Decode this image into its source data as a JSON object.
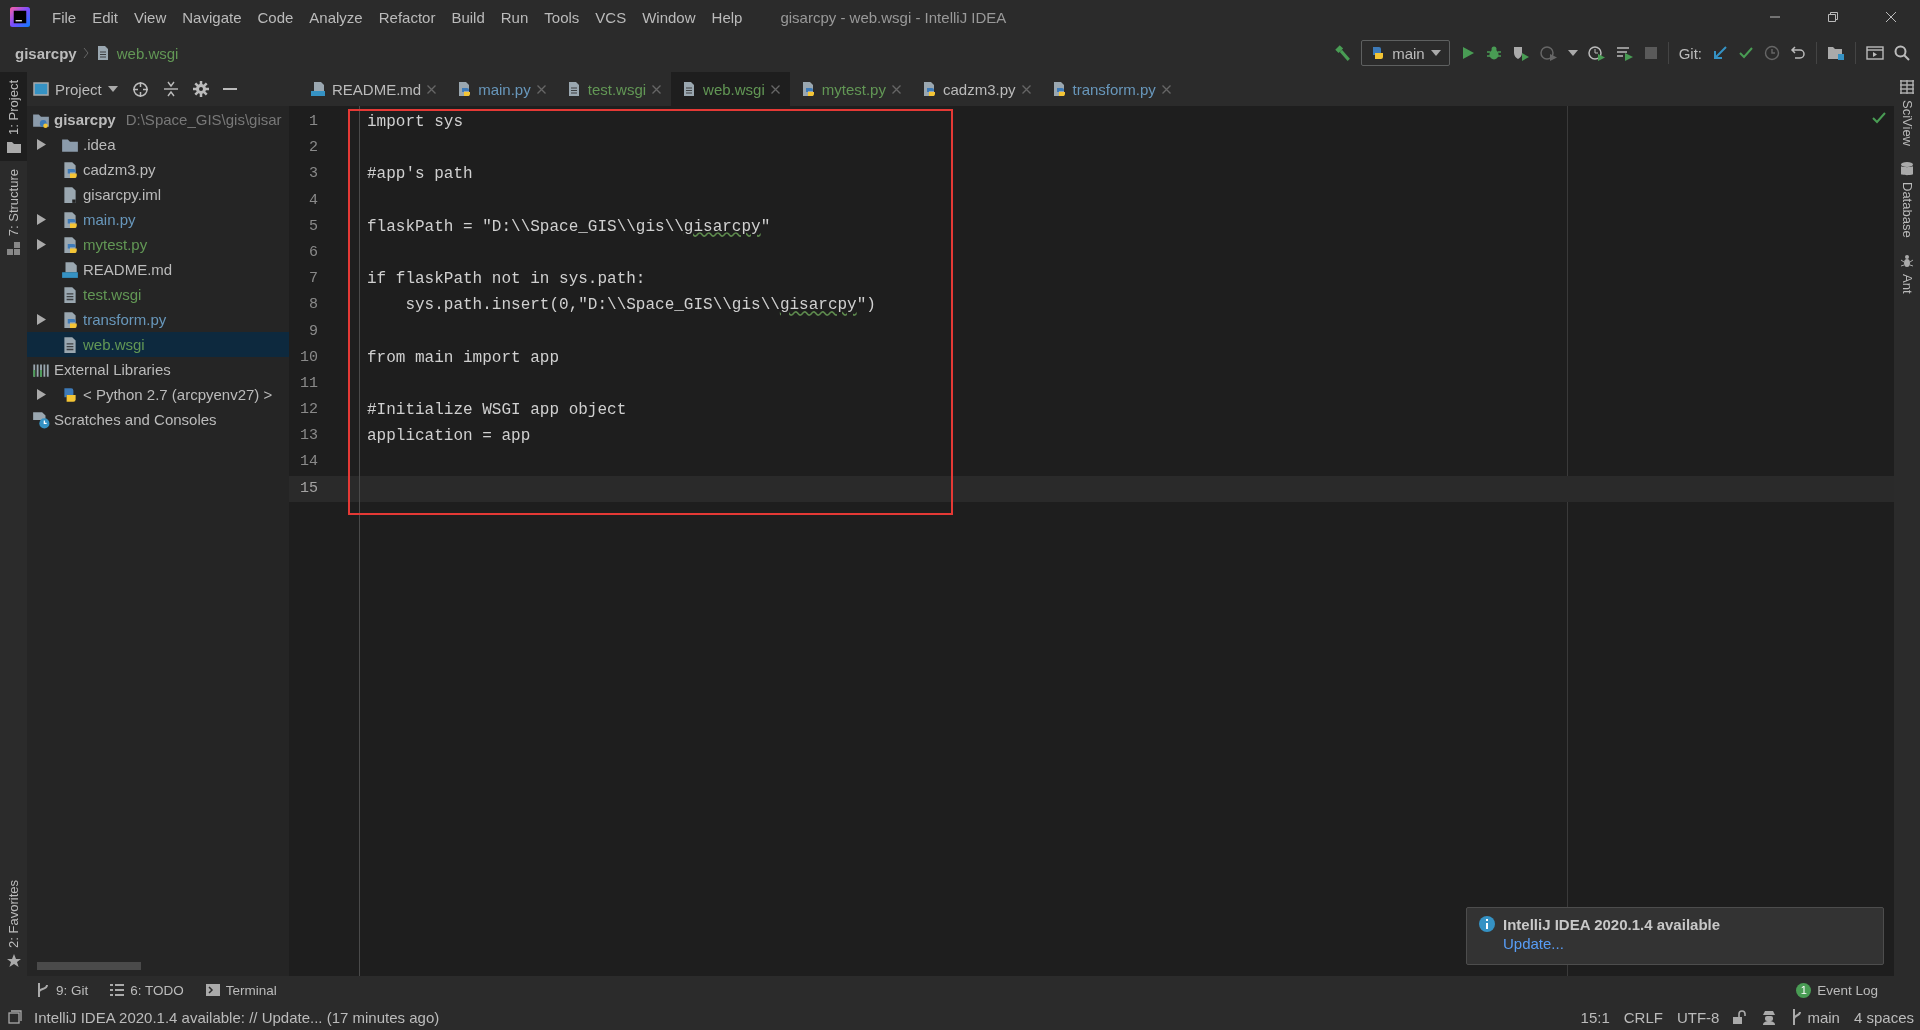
{
  "window": {
    "title": "gisarcpy - web.wsgi - IntelliJ IDEA"
  },
  "menu": [
    "File",
    "Edit",
    "View",
    "Navigate",
    "Code",
    "Analyze",
    "Refactor",
    "Build",
    "Run",
    "Tools",
    "VCS",
    "Window",
    "Help"
  ],
  "breadcrumb": [
    {
      "text": "gisarcpy",
      "kind": "project"
    },
    {
      "text": "web.wsgi",
      "kind": "file",
      "color": "#629755"
    }
  ],
  "toolbar": {
    "run_config": "main",
    "git_label": "Git:"
  },
  "left_stripe": {
    "top": [
      {
        "label": "1: Project",
        "kind": "project",
        "selected": true
      },
      {
        "label": "7: Structure",
        "kind": "structure",
        "selected": false
      }
    ],
    "bottom": [
      {
        "label": "2: Favorites",
        "kind": "favorites",
        "selected": false
      }
    ]
  },
  "project_panel": {
    "title": "Project",
    "tree": [
      {
        "name": "gisarcpy",
        "path": "D:\\Space_GIS\\gis\\gisar",
        "kind": "project",
        "selected": false,
        "children": [
          {
            "name": ".idea",
            "kind": "folder",
            "color": "#bbbbbb",
            "expanded": false,
            "selected": false
          },
          {
            "name": "cadzm3.py",
            "kind": "python",
            "color": "#bbbbbb",
            "selected": false
          },
          {
            "name": "gisarcpy.iml",
            "kind": "module",
            "color": "#bbbbbb",
            "selected": false
          },
          {
            "name": "main.py",
            "kind": "python",
            "color": "#6897bb",
            "expanded": false,
            "selected": false
          },
          {
            "name": "mytest.py",
            "kind": "python",
            "color": "#629755",
            "expanded": false,
            "selected": false
          },
          {
            "name": "README.md",
            "kind": "markdown",
            "color": "#bbbbbb",
            "selected": false
          },
          {
            "name": "test.wsgi",
            "kind": "text",
            "color": "#629755",
            "selected": false
          },
          {
            "name": "transform.py",
            "kind": "python",
            "color": "#6897bb",
            "expanded": false,
            "selected": false
          },
          {
            "name": "web.wsgi",
            "kind": "text",
            "color": "#629755",
            "selected": true
          }
        ]
      },
      {
        "name": "External Libraries",
        "kind": "libraries",
        "selected": false,
        "children": [
          {
            "name": "< Python 2.7 (arcpyenv27) >",
            "kind": "sdk",
            "expanded": false,
            "selected": false
          }
        ]
      },
      {
        "name": "Scratches and Consoles",
        "kind": "scratches",
        "selected": false
      }
    ]
  },
  "editor": {
    "tabs": [
      {
        "label": "README.md",
        "kind": "markdown",
        "color": "#bbbbbb",
        "selected": false
      },
      {
        "label": "main.py",
        "kind": "python",
        "color": "#6897bb",
        "selected": false
      },
      {
        "label": "test.wsgi",
        "kind": "text",
        "color": "#629755",
        "selected": false
      },
      {
        "label": "web.wsgi",
        "kind": "text",
        "color": "#629755",
        "selected": true
      },
      {
        "label": "mytest.py",
        "kind": "python",
        "color": "#629755",
        "selected": false
      },
      {
        "label": "cadzm3.py",
        "kind": "python",
        "color": "#bbbbbb",
        "selected": false
      },
      {
        "label": "transform.py",
        "kind": "python",
        "color": "#6897bb",
        "selected": false
      }
    ],
    "lines": [
      {
        "number": "1",
        "text": "import sys",
        "current": false
      },
      {
        "number": "2",
        "current": false
      },
      {
        "number": "3",
        "text": "#app's path",
        "current": false
      },
      {
        "number": "4",
        "current": false
      },
      {
        "number": "5",
        "segments": [
          {
            "text": "flaskPath = \"D:\\\\Space_GIS\\\\gis\\\\",
            "typo": false
          },
          {
            "text": "gisarcpy",
            "typo": true
          },
          {
            "text": "\"",
            "typo": false
          }
        ],
        "current": false
      },
      {
        "number": "6",
        "current": false
      },
      {
        "number": "7",
        "text": "if flaskPath not in sys.path:",
        "current": false
      },
      {
        "number": "8",
        "segments": [
          {
            "text": "    sys.path.insert(0,\"D:\\\\Space_GIS\\\\gis\\\\",
            "typo": false
          },
          {
            "text": "gisarcpy",
            "typo": true
          },
          {
            "text": "\")",
            "typo": false
          }
        ],
        "current": false
      },
      {
        "number": "9",
        "current": false
      },
      {
        "number": "10",
        "text": "from main import app",
        "current": false
      },
      {
        "number": "11",
        "current": false
      },
      {
        "number": "12",
        "text": "#Initialize WSGI app object",
        "current": false
      },
      {
        "number": "13",
        "text": "application = app",
        "current": false
      },
      {
        "number": "14",
        "current": false
      },
      {
        "number": "15",
        "current": true
      }
    ]
  },
  "right_stripe": [
    {
      "label": "SciView",
      "kind": "sciview"
    },
    {
      "label": "Database",
      "kind": "database"
    },
    {
      "label": "Ant",
      "kind": "ant"
    }
  ],
  "notification": {
    "title": "IntelliJ IDEA 2020.1.4 available",
    "link": "Update..."
  },
  "tool_buttons": [
    {
      "label": "9: Git",
      "kind": "git"
    },
    {
      "label": "6: TODO",
      "kind": "todo"
    },
    {
      "label": "Terminal",
      "kind": "terminal"
    }
  ],
  "event_log": {
    "count": "1",
    "label": "Event Log"
  },
  "status_bar": {
    "message": "IntelliJ IDEA 2020.1.4 available: // Update... (17 minutes ago)",
    "caret": "15:1",
    "line_separator": "CRLF",
    "encoding": "UTF-8",
    "branch": "main",
    "indent": "4 spaces"
  }
}
